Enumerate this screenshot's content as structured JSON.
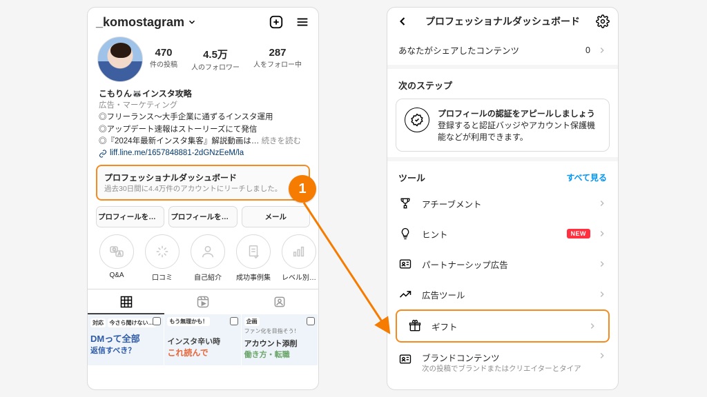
{
  "annotation": {
    "step": "1"
  },
  "left": {
    "username": "_komostagram",
    "stats": {
      "posts": {
        "value": "470",
        "label": "件の投稿"
      },
      "followers": {
        "value": "4.5万",
        "label": "人のフォロワー"
      },
      "following": {
        "value": "287",
        "label": "人をフォロー中"
      }
    },
    "bio": {
      "name": "こもりん🦝インスタ攻略",
      "category": "広告・マーケティング",
      "line1": "◎フリーランス〜大手企業に通ずるインスタ運用",
      "line2": "◎アップデート速報はストーリーズにて発信",
      "line3": "◎『2024年最新インスタ集客』解説動画は…",
      "readmore": "続きを読む",
      "link": "liff.line.me/1657848881-2dGNzEeM/la"
    },
    "dash": {
      "title": "プロフェッショナルダッシュボード",
      "sub": "過去30日間に4.4万件のアカウントにリーチしました。"
    },
    "buttons": {
      "edit": "プロフィールを編集",
      "share": "プロフィールをシ…",
      "mail": "メール"
    },
    "highlights": [
      {
        "label": "Q&A"
      },
      {
        "label": "口コミ"
      },
      {
        "label": "自己紹介"
      },
      {
        "label": "成功事例集"
      },
      {
        "label": "レベル別…"
      }
    ],
    "posts": {
      "p0": {
        "tag0": "対応",
        "tag1": "今さら聞けない…",
        "big0": "DMって全部",
        "big1": "返信すべき？"
      },
      "p1": {
        "tag0": "もう無理かも！",
        "big0": "インスタ辛い時",
        "big1": "これ読んで"
      },
      "p2": {
        "tag0": "企画",
        "sub0": "ファン化を目指そう！",
        "big0": "アカウント添削",
        "big1": "働き方・転職"
      }
    }
  },
  "right": {
    "title": "プロフェッショナルダッシュボード",
    "shared": {
      "label": "あなたがシェアしたコンテンツ",
      "value": "0"
    },
    "next_steps": "次のステップ",
    "card": {
      "title": "プロフィールの認証をアピールしましょう",
      "sub": "登録すると認証バッジやアカウント保護機能などが利用できます。"
    },
    "tools": {
      "header": "ツール",
      "seeall": "すべて見る"
    },
    "items": {
      "achieve": "アチーブメント",
      "hint": "ヒント",
      "new": "NEW",
      "partner": "パートナーシップ広告",
      "adtool": "広告ツール",
      "gift": "ギフト",
      "brand": {
        "title": "ブランドコンテンツ",
        "sub": "次の投稿でブランドまたはクリエイターとタイア"
      }
    }
  }
}
